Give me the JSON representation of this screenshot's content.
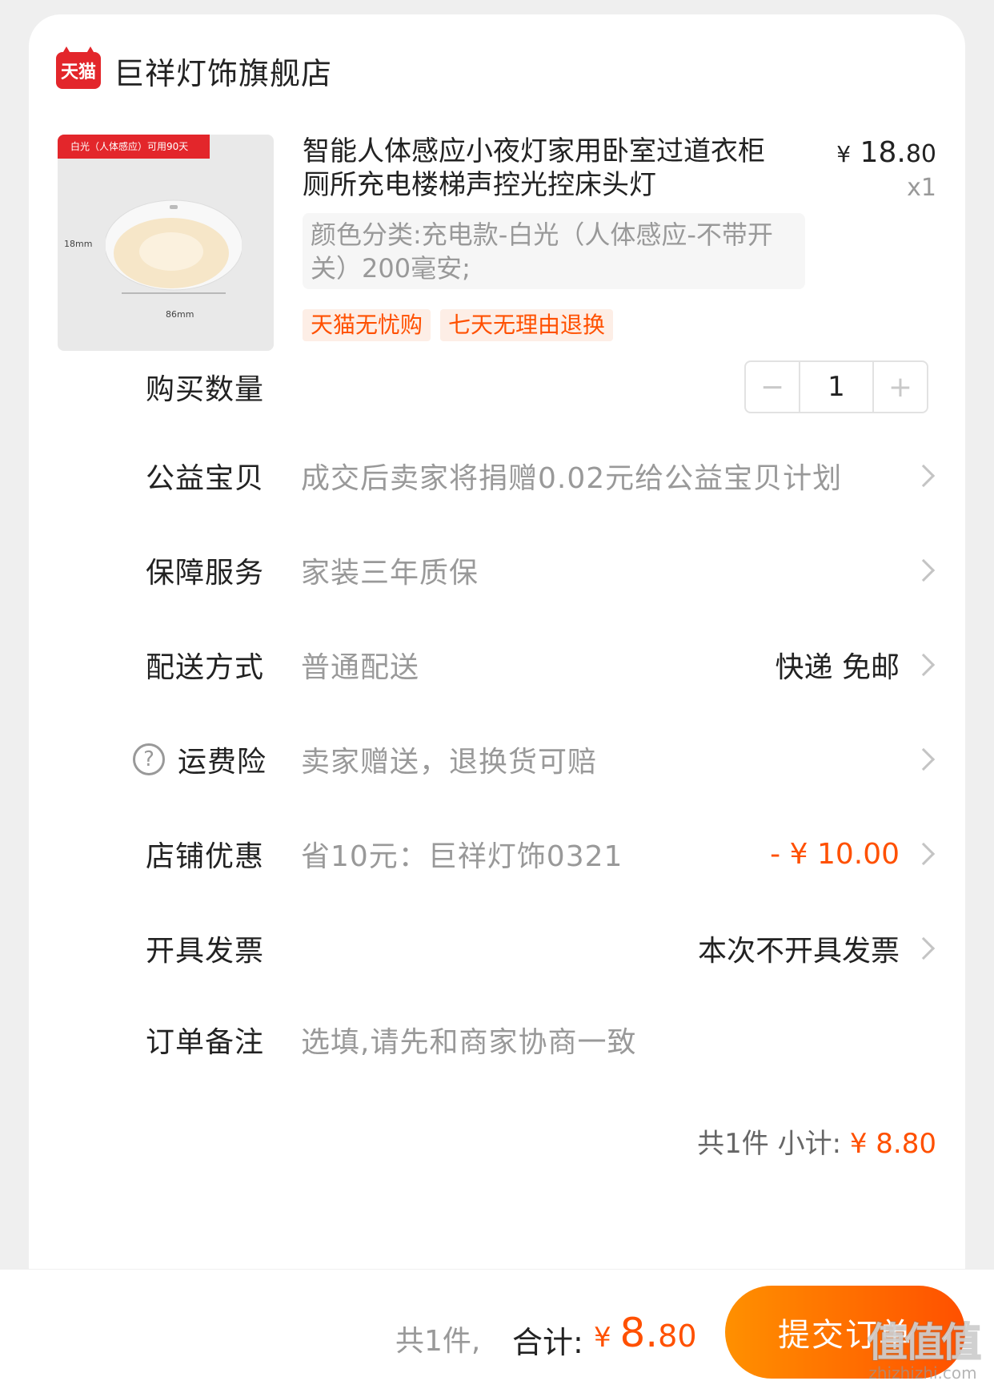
{
  "shop": {
    "logo_text": "天猫",
    "name": "巨祥灯饰旗舰店"
  },
  "product": {
    "image_banner": "白光（人体感应）可用90天",
    "image_dim_height": "18mm",
    "image_dim_width": "86mm",
    "title": "智能人体感应小夜灯家用卧室过道衣柜厕所充电楼梯声控光控床头灯",
    "price_yen": "¥",
    "price_int": " 18.",
    "price_dec": "80",
    "quantity_mark": "x1",
    "sku": "颜色分类:充电款-白光（人体感应-不带开关）200毫安;",
    "tags": [
      "天猫无忧购",
      "七天无理由退换"
    ]
  },
  "rows": {
    "quantity": {
      "label": "购买数量",
      "value": "1",
      "minus": "−",
      "plus": "+"
    },
    "charity": {
      "label": "公益宝贝",
      "value": "成交后卖家将捐赠0.02元给公益宝贝计划"
    },
    "warranty": {
      "label": "保障服务",
      "value": "家装三年质保"
    },
    "delivery": {
      "label": "配送方式",
      "value": "普通配送",
      "right": "快递 免邮"
    },
    "shipping_insurance": {
      "icon": "?",
      "label": "运费险",
      "value": "卖家赠送，退换货可赔"
    },
    "shop_discount": {
      "label": "店铺优惠",
      "value": "省10元：巨祥灯饰0321",
      "right": "- ¥ 10.00"
    },
    "invoice": {
      "label": "开具发票",
      "right": "本次不开具发票"
    },
    "note": {
      "label": "订单备注",
      "placeholder": "选填,请先和商家协商一致"
    }
  },
  "subtotal": {
    "count": "共1件 小计:",
    "amount": " ¥ 8.80"
  },
  "footer": {
    "count": "共1件,",
    "total_label": "合计:",
    "total_yen": "¥ ",
    "total_int": "8.",
    "total_dec": "80",
    "submit_label": "提交订单"
  },
  "watermark": {
    "big": "值值值",
    "small": "zhizhizhi.com"
  },
  "colors": {
    "accent": "#ff5000",
    "tmall_red": "#e3262b"
  }
}
